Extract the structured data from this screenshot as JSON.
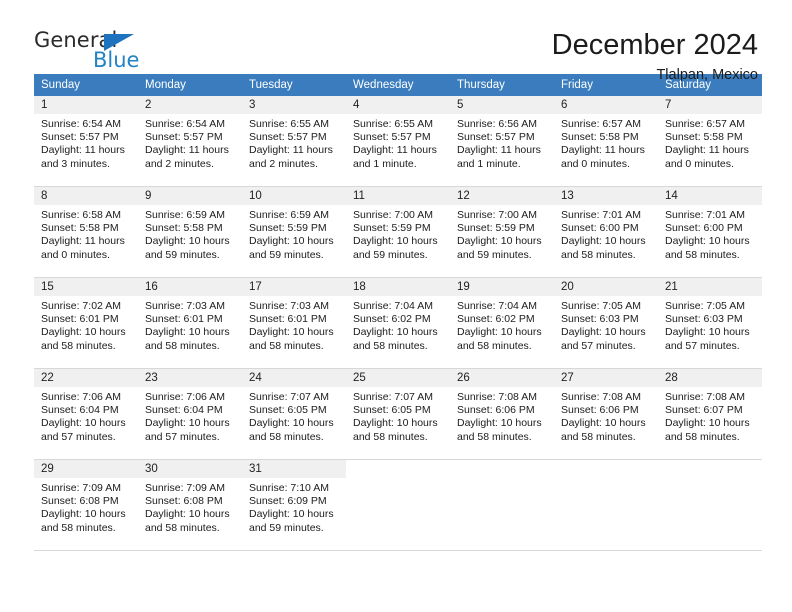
{
  "brand": {
    "name_part1": "General",
    "name_part2": "Blue"
  },
  "header": {
    "month_title": "December 2024",
    "location": "Tlalpan, Mexico"
  },
  "theme": {
    "header_blue": "#3a7cbd",
    "logo_blue": "#2383c4",
    "daynum_bg": "#f0f0f0",
    "row_divider": "#d8d8d8"
  },
  "calendar": {
    "weekday_headers": [
      "Sunday",
      "Monday",
      "Tuesday",
      "Wednesday",
      "Thursday",
      "Friday",
      "Saturday"
    ],
    "weeks": [
      [
        {
          "day": "1",
          "sunrise": "Sunrise: 6:54 AM",
          "sunset": "Sunset: 5:57 PM",
          "daylight": "Daylight: 11 hours and 3 minutes."
        },
        {
          "day": "2",
          "sunrise": "Sunrise: 6:54 AM",
          "sunset": "Sunset: 5:57 PM",
          "daylight": "Daylight: 11 hours and 2 minutes."
        },
        {
          "day": "3",
          "sunrise": "Sunrise: 6:55 AM",
          "sunset": "Sunset: 5:57 PM",
          "daylight": "Daylight: 11 hours and 2 minutes."
        },
        {
          "day": "4",
          "sunrise": "Sunrise: 6:55 AM",
          "sunset": "Sunset: 5:57 PM",
          "daylight": "Daylight: 11 hours and 1 minute."
        },
        {
          "day": "5",
          "sunrise": "Sunrise: 6:56 AM",
          "sunset": "Sunset: 5:57 PM",
          "daylight": "Daylight: 11 hours and 1 minute."
        },
        {
          "day": "6",
          "sunrise": "Sunrise: 6:57 AM",
          "sunset": "Sunset: 5:58 PM",
          "daylight": "Daylight: 11 hours and 0 minutes."
        },
        {
          "day": "7",
          "sunrise": "Sunrise: 6:57 AM",
          "sunset": "Sunset: 5:58 PM",
          "daylight": "Daylight: 11 hours and 0 minutes."
        }
      ],
      [
        {
          "day": "8",
          "sunrise": "Sunrise: 6:58 AM",
          "sunset": "Sunset: 5:58 PM",
          "daylight": "Daylight: 11 hours and 0 minutes."
        },
        {
          "day": "9",
          "sunrise": "Sunrise: 6:59 AM",
          "sunset": "Sunset: 5:58 PM",
          "daylight": "Daylight: 10 hours and 59 minutes."
        },
        {
          "day": "10",
          "sunrise": "Sunrise: 6:59 AM",
          "sunset": "Sunset: 5:59 PM",
          "daylight": "Daylight: 10 hours and 59 minutes."
        },
        {
          "day": "11",
          "sunrise": "Sunrise: 7:00 AM",
          "sunset": "Sunset: 5:59 PM",
          "daylight": "Daylight: 10 hours and 59 minutes."
        },
        {
          "day": "12",
          "sunrise": "Sunrise: 7:00 AM",
          "sunset": "Sunset: 5:59 PM",
          "daylight": "Daylight: 10 hours and 59 minutes."
        },
        {
          "day": "13",
          "sunrise": "Sunrise: 7:01 AM",
          "sunset": "Sunset: 6:00 PM",
          "daylight": "Daylight: 10 hours and 58 minutes."
        },
        {
          "day": "14",
          "sunrise": "Sunrise: 7:01 AM",
          "sunset": "Sunset: 6:00 PM",
          "daylight": "Daylight: 10 hours and 58 minutes."
        }
      ],
      [
        {
          "day": "15",
          "sunrise": "Sunrise: 7:02 AM",
          "sunset": "Sunset: 6:01 PM",
          "daylight": "Daylight: 10 hours and 58 minutes."
        },
        {
          "day": "16",
          "sunrise": "Sunrise: 7:03 AM",
          "sunset": "Sunset: 6:01 PM",
          "daylight": "Daylight: 10 hours and 58 minutes."
        },
        {
          "day": "17",
          "sunrise": "Sunrise: 7:03 AM",
          "sunset": "Sunset: 6:01 PM",
          "daylight": "Daylight: 10 hours and 58 minutes."
        },
        {
          "day": "18",
          "sunrise": "Sunrise: 7:04 AM",
          "sunset": "Sunset: 6:02 PM",
          "daylight": "Daylight: 10 hours and 58 minutes."
        },
        {
          "day": "19",
          "sunrise": "Sunrise: 7:04 AM",
          "sunset": "Sunset: 6:02 PM",
          "daylight": "Daylight: 10 hours and 58 minutes."
        },
        {
          "day": "20",
          "sunrise": "Sunrise: 7:05 AM",
          "sunset": "Sunset: 6:03 PM",
          "daylight": "Daylight: 10 hours and 57 minutes."
        },
        {
          "day": "21",
          "sunrise": "Sunrise: 7:05 AM",
          "sunset": "Sunset: 6:03 PM",
          "daylight": "Daylight: 10 hours and 57 minutes."
        }
      ],
      [
        {
          "day": "22",
          "sunrise": "Sunrise: 7:06 AM",
          "sunset": "Sunset: 6:04 PM",
          "daylight": "Daylight: 10 hours and 57 minutes."
        },
        {
          "day": "23",
          "sunrise": "Sunrise: 7:06 AM",
          "sunset": "Sunset: 6:04 PM",
          "daylight": "Daylight: 10 hours and 57 minutes."
        },
        {
          "day": "24",
          "sunrise": "Sunrise: 7:07 AM",
          "sunset": "Sunset: 6:05 PM",
          "daylight": "Daylight: 10 hours and 58 minutes."
        },
        {
          "day": "25",
          "sunrise": "Sunrise: 7:07 AM",
          "sunset": "Sunset: 6:05 PM",
          "daylight": "Daylight: 10 hours and 58 minutes."
        },
        {
          "day": "26",
          "sunrise": "Sunrise: 7:08 AM",
          "sunset": "Sunset: 6:06 PM",
          "daylight": "Daylight: 10 hours and 58 minutes."
        },
        {
          "day": "27",
          "sunrise": "Sunrise: 7:08 AM",
          "sunset": "Sunset: 6:06 PM",
          "daylight": "Daylight: 10 hours and 58 minutes."
        },
        {
          "day": "28",
          "sunrise": "Sunrise: 7:08 AM",
          "sunset": "Sunset: 6:07 PM",
          "daylight": "Daylight: 10 hours and 58 minutes."
        }
      ],
      [
        {
          "day": "29",
          "sunrise": "Sunrise: 7:09 AM",
          "sunset": "Sunset: 6:08 PM",
          "daylight": "Daylight: 10 hours and 58 minutes."
        },
        {
          "day": "30",
          "sunrise": "Sunrise: 7:09 AM",
          "sunset": "Sunset: 6:08 PM",
          "daylight": "Daylight: 10 hours and 58 minutes."
        },
        {
          "day": "31",
          "sunrise": "Sunrise: 7:10 AM",
          "sunset": "Sunset: 6:09 PM",
          "daylight": "Daylight: 10 hours and 59 minutes."
        },
        null,
        null,
        null,
        null
      ]
    ]
  }
}
